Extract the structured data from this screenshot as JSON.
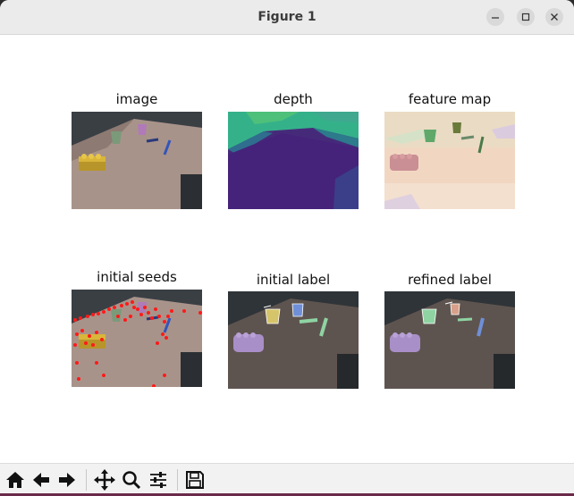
{
  "window": {
    "title": "Figure 1"
  },
  "panels": {
    "image": {
      "title": "image"
    },
    "depth": {
      "title": "depth"
    },
    "feature_map": {
      "title": "feature map"
    },
    "initial_seeds": {
      "title": "initial seeds"
    },
    "initial_label": {
      "title": "initial label"
    },
    "refined_label": {
      "title": "refined label"
    }
  },
  "toolbar": {
    "buttons": [
      "home-icon",
      "back-arrow-icon",
      "forward-arrow-icon",
      "pan-icon",
      "zoom-icon",
      "configure-subplots-icon",
      "save-icon"
    ]
  },
  "colors": {
    "titlebar": "#ebebeb",
    "toolbar": "#f2f2f2",
    "seed_points": "#ff0000",
    "label_purple": "#a98fc8",
    "label_yellow": "#d6c46a",
    "label_green": "#8fd3a3",
    "label_blue": "#6f8fd8"
  }
}
